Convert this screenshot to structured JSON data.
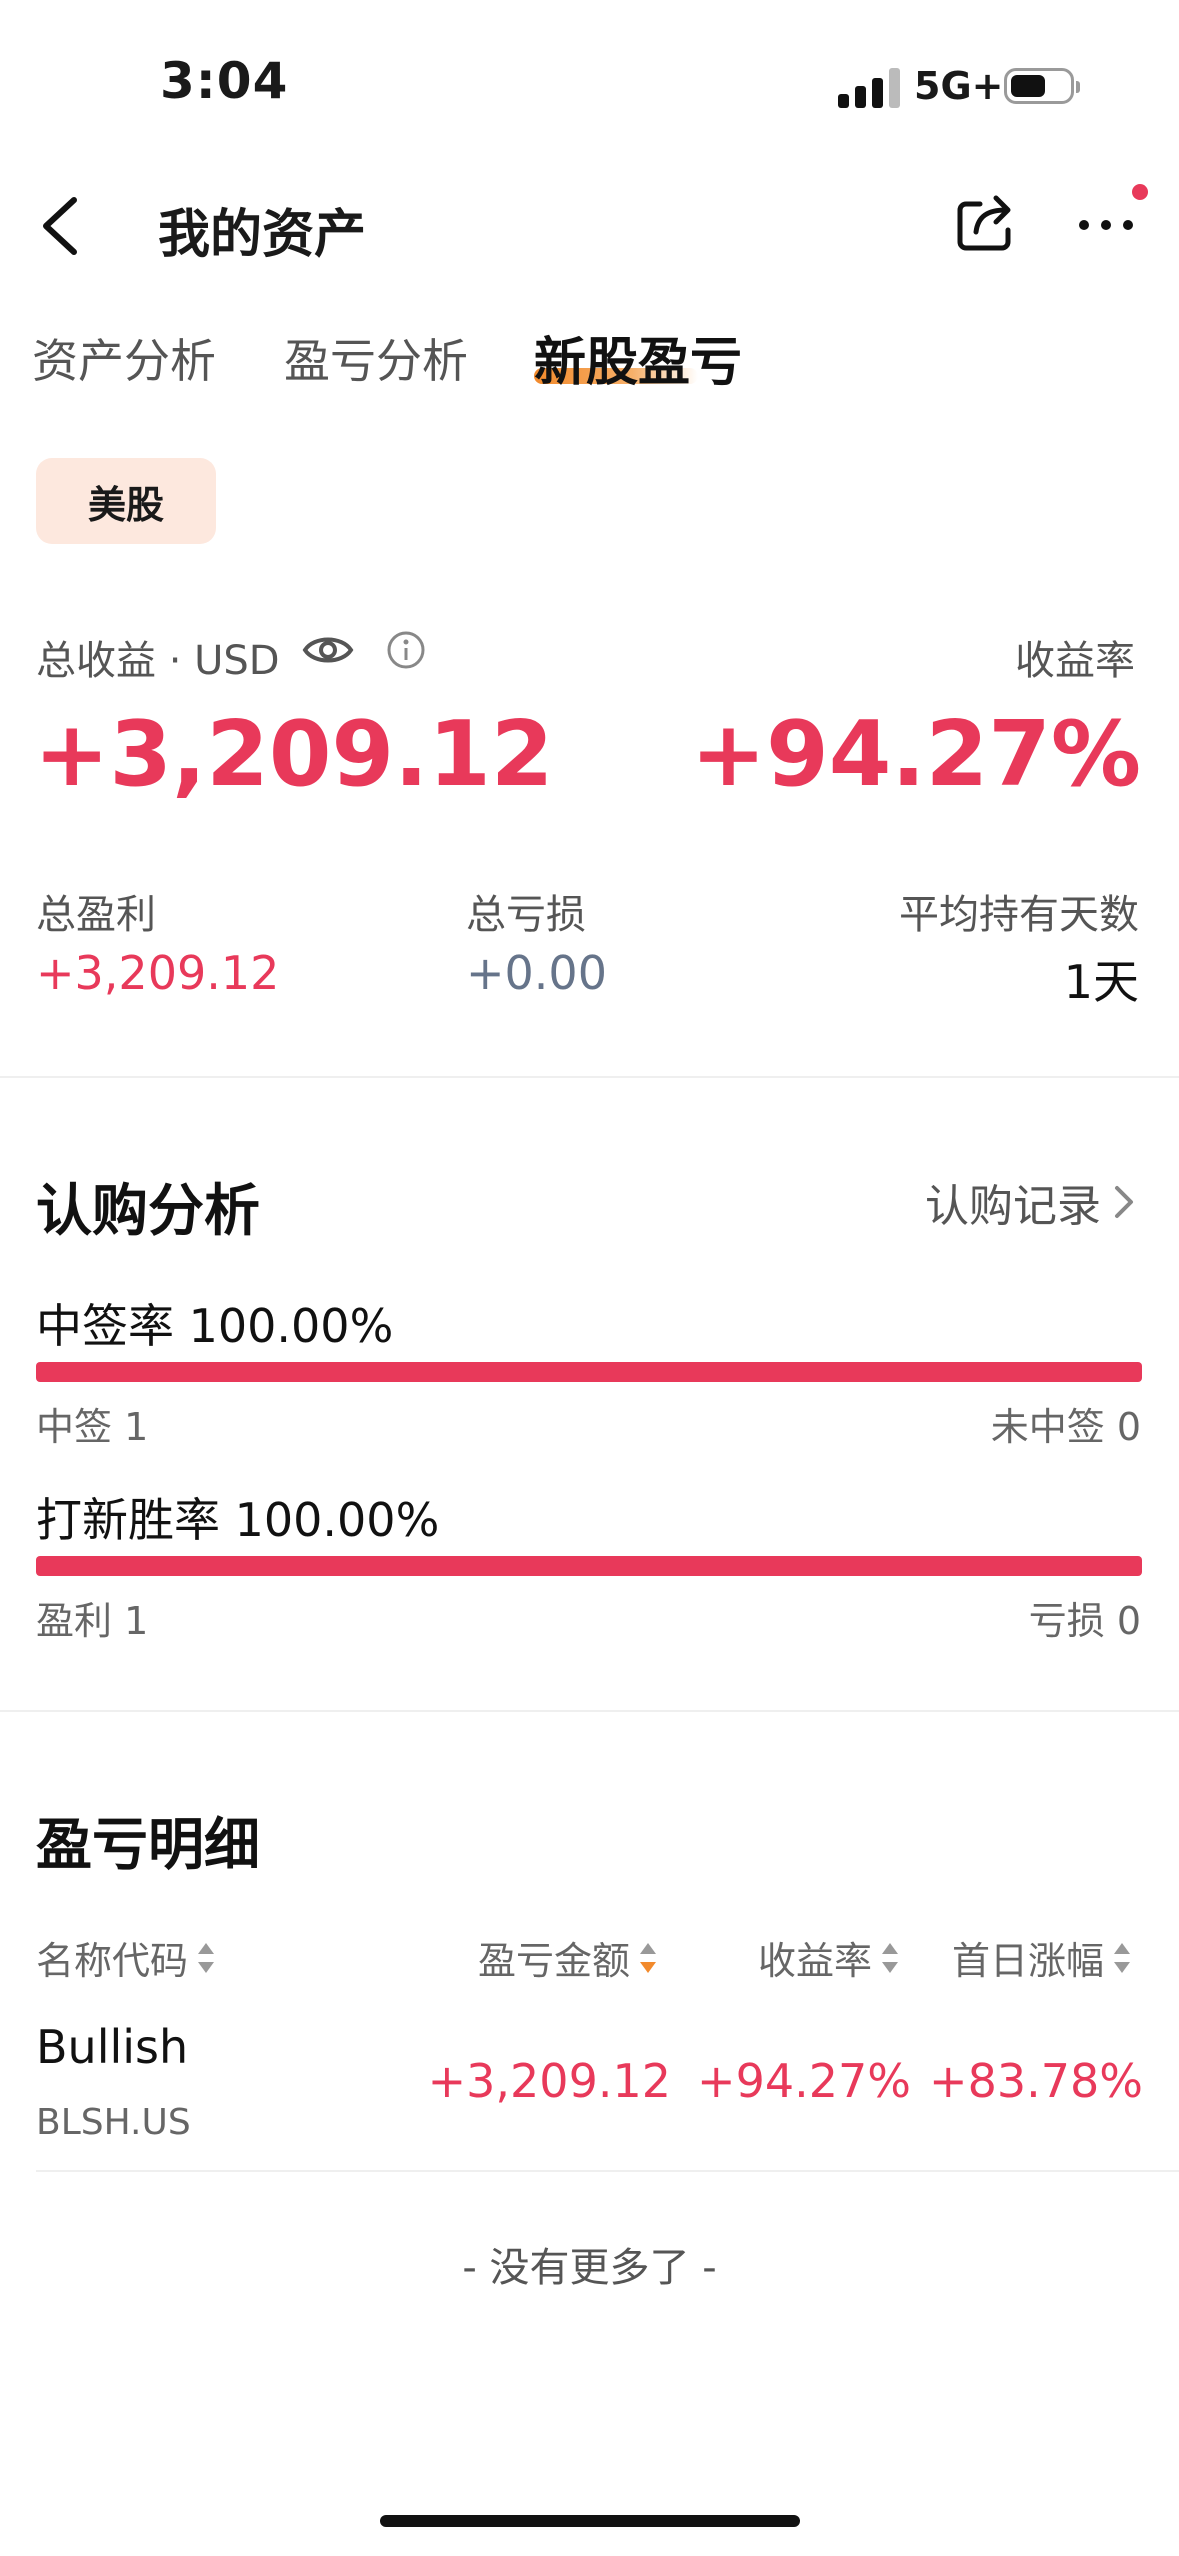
{
  "status": {
    "time": "3:04",
    "network": "5G+"
  },
  "nav": {
    "title": "我的资产"
  },
  "tabs": [
    {
      "label": "资产分析"
    },
    {
      "label": "盈亏分析"
    },
    {
      "label": "新股盈亏",
      "active": true
    }
  ],
  "market_chip": "美股",
  "summary": {
    "total_label": "总收益 · USD",
    "total_value": "+3,209.12",
    "rate_label": "收益率",
    "rate_value": "+94.27%",
    "profit_label": "总盈利",
    "profit_value": "+3,209.12",
    "loss_label": "总亏损",
    "loss_value": "+0.00",
    "days_label": "平均持有天数",
    "days_value": "1天"
  },
  "subscription": {
    "title": "认购分析",
    "link": "认购记录",
    "win_rate_text": "中签率 100.00%",
    "win_rate": 1.0,
    "win_label": "中签 1",
    "miss_label": "未中签 0",
    "ipo_rate_text": "打新胜率 100.00%",
    "ipo_rate": 1.0,
    "profit_count": "盈利 1",
    "loss_count": "亏损 0"
  },
  "detail": {
    "title": "盈亏明细",
    "headers": [
      "名称代码",
      "盈亏金额",
      "收益率",
      "首日涨幅"
    ],
    "rows": [
      {
        "name": "Bullish",
        "code": "BLSH.US",
        "pl": "+3,209.12",
        "rate": "+94.27%",
        "first_day": "+83.78%"
      }
    ],
    "footer": "- 没有更多了 -"
  },
  "colors": {
    "accent_red": "#e8395a",
    "accent_orange": "#f28a2c",
    "chip_bg": "#fde8de"
  }
}
